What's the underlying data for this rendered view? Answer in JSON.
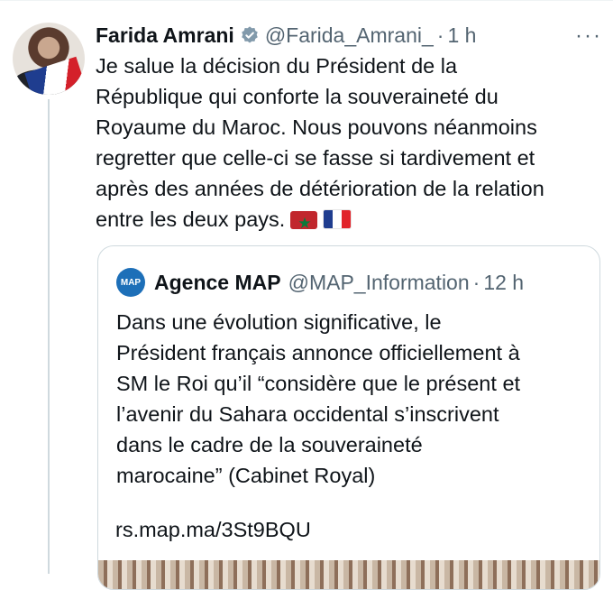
{
  "tweet": {
    "author_name": "Farida Amrani",
    "handle": "@Farida_Amrani_",
    "separator": "·",
    "time": "1 h",
    "more_label": "···",
    "text_lines": [
      "Je salue la décision du Président de la",
      "République qui conforte la souveraineté du",
      "Royaume du Maroc. Nous pouvons néanmoins",
      "regretter que celle-ci se fasse si tardivement et",
      "après des années de détérioration de la relation",
      "entre les deux pays."
    ],
    "flags": [
      "morocco-flag",
      "france-flag"
    ]
  },
  "quote": {
    "avatar_label": "MAP",
    "author_name": "Agence MAP",
    "handle": "@MAP_Information",
    "separator": "·",
    "time": "12 h",
    "text_lines": [
      "Dans une évolution significative, le",
      "Président français annonce officiellement à",
      "SM le Roi qu’il “considère que le présent et",
      "l’avenir du Sahara occidental s’inscrivent",
      "dans le cadre de la souveraineté",
      "marocaine” (Cabinet Royal)"
    ],
    "link": "rs.map.ma/3St9BQU"
  },
  "colors": {
    "text": "#0f1419",
    "secondary": "#536471",
    "verified": "#829aab",
    "border": "#cfd9de",
    "map_blue": "#1d6fb8"
  }
}
